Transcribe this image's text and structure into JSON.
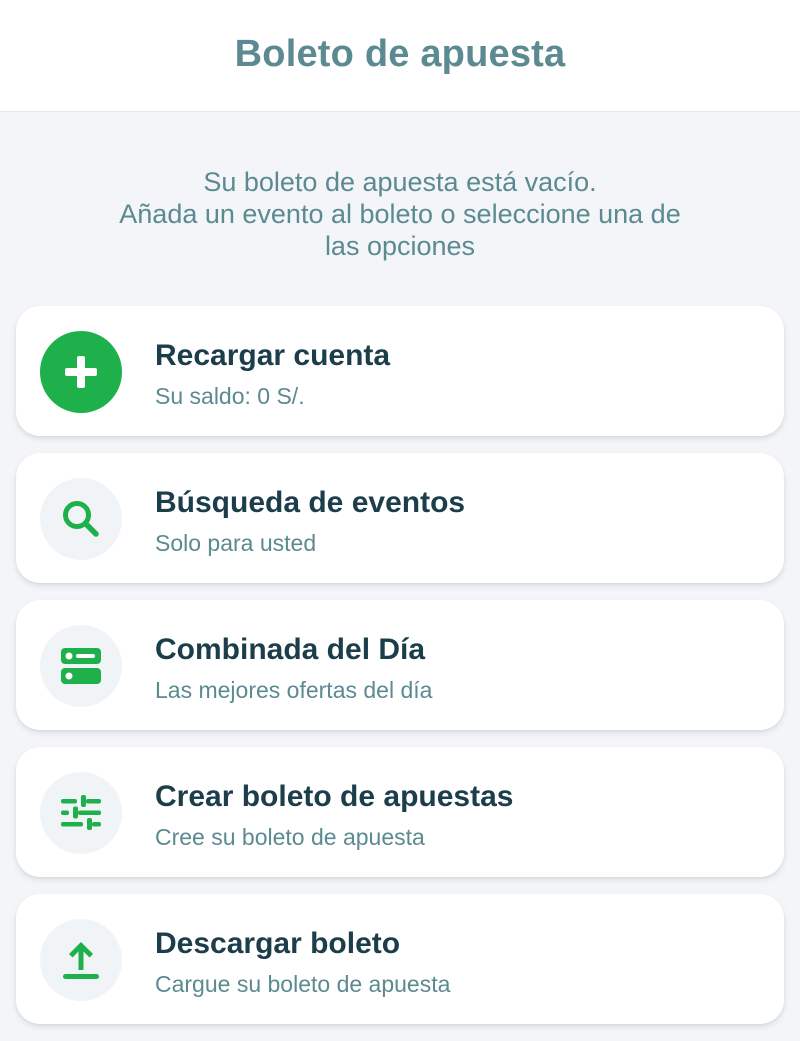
{
  "header": {
    "title": "Boleto de apuesta"
  },
  "empty_state": {
    "lines": [
      "Su boleto de apuesta está vacío.",
      "Añada un evento al boleto o seleccione una de",
      "las opciones"
    ]
  },
  "options": [
    {
      "title": "Recargar cuenta",
      "subtitle": "Su saldo: 0 S/.",
      "icon": "plus-icon"
    },
    {
      "title": "Búsqueda de eventos",
      "subtitle": "Solo para usted",
      "icon": "search-icon"
    },
    {
      "title": "Combinada del Día",
      "subtitle": "Las mejores ofertas del día",
      "icon": "combo-list-icon"
    },
    {
      "title": "Crear boleto de apuestas",
      "subtitle": "Cree su boleto de apuesta",
      "icon": "sliders-icon"
    },
    {
      "title": "Descargar boleto",
      "subtitle": "Cargue su boleto de apuesta",
      "icon": "upload-icon"
    }
  ],
  "colors": {
    "accent_green": "#1eb04a",
    "title_teal": "#5b8a91",
    "text_dark": "#1c3d4a",
    "background": "#f3f5f8"
  }
}
